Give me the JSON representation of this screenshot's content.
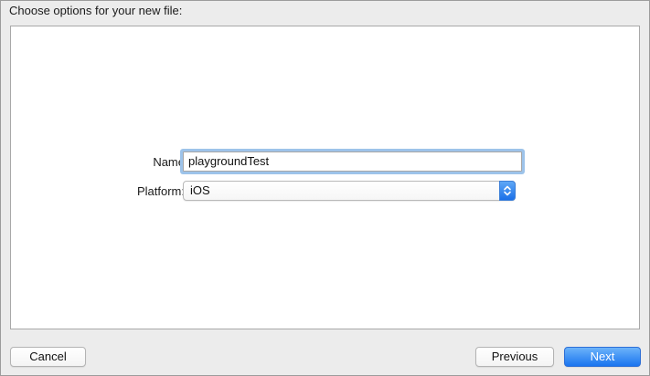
{
  "header": {
    "title": "Choose options for your new file:"
  },
  "form": {
    "name_label": "Name",
    "name_value": "playgroundTest",
    "platform_label": "Platform:",
    "platform_value": "iOS"
  },
  "footer": {
    "cancel_label": "Cancel",
    "previous_label": "Previous",
    "next_label": "Next"
  },
  "colors": {
    "accent": "#1a74ef",
    "focus_ring": "#9dc3ea",
    "window_bg": "#ececec"
  }
}
